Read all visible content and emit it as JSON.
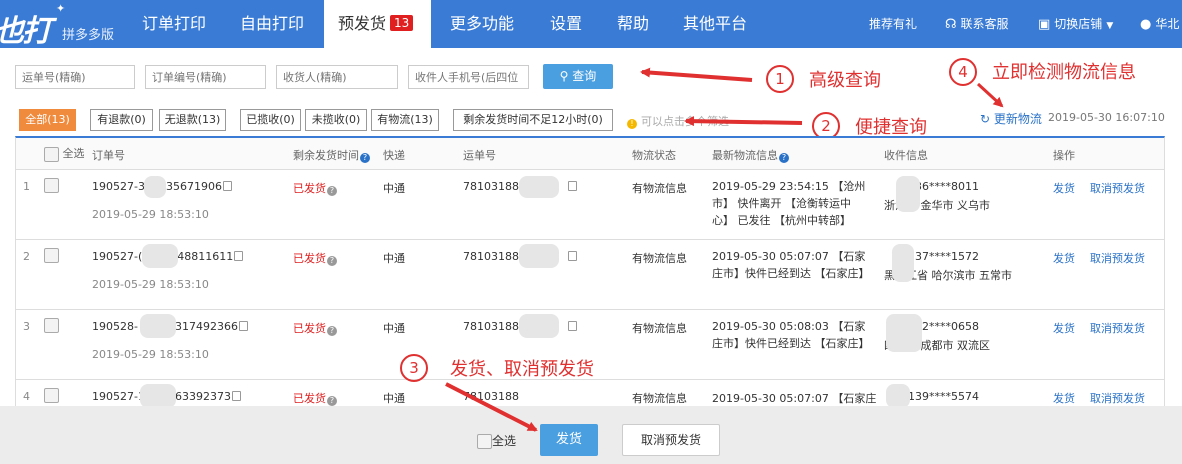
{
  "app": {
    "logo_text": "也打",
    "logo_sub": "拼多多版"
  },
  "nav": {
    "items": [
      {
        "label": "订单打印"
      },
      {
        "label": "自由打印"
      },
      {
        "label": "预发货",
        "badge": "13"
      },
      {
        "label": "更多功能"
      },
      {
        "label": "设置"
      },
      {
        "label": "帮助"
      },
      {
        "label": "其他平台"
      }
    ],
    "right": {
      "recommend": "推荐有礼",
      "contact": "联系客服",
      "switch_shop": "切换店铺",
      "user": "华北"
    }
  },
  "search": {
    "waybill_placeholder": "运单号(精确)",
    "order_placeholder": "订单编号(精确)",
    "receiver_placeholder": "收货人(精确)",
    "phone_placeholder": "收件人手机号(后四位",
    "query_label": "查询"
  },
  "annotations": {
    "a1_num": "1",
    "a1_text": "高级查询",
    "a2_num": "2",
    "a2_text": "便捷查询",
    "a3_num": "3",
    "a3_text": "发货、取消预发货",
    "a4_num": "4",
    "a4_text": "立即检测物流信息"
  },
  "filters": {
    "tabs": [
      {
        "label": "全部(13)"
      },
      {
        "label": "有退款(0)"
      },
      {
        "label": "无退款(13)"
      },
      {
        "label": "已揽收(0)"
      },
      {
        "label": "未揽收(0)"
      },
      {
        "label": "有物流(13)"
      },
      {
        "label": "剩余发货时间不足12小时(0)"
      }
    ],
    "hint": "可以点击多个筛选",
    "refresh_label": "更新物流",
    "refresh_time": "2019-05-30 16:07:10"
  },
  "table": {
    "headers": {
      "select_all": "全选",
      "order_no": "订单号",
      "remaining": "剩余发货时间",
      "express": "快递",
      "waybill": "运单号",
      "logistics_status": "物流状态",
      "latest_logistics": "最新物流信息",
      "receiver": "收件信息",
      "action": "操作"
    },
    "rows": [
      {
        "index": "1",
        "order_no": "190527-3",
        "order_no_tail": "035671906",
        "order_time": "2019-05-29 18:53:10",
        "remaining": "已发货",
        "express": "中通",
        "waybill": "78103188",
        "logistics_status": "有物流信息",
        "latest_logistics": "2019-05-29 23:54:15 【沧州市】 快件离开 【沧衡转运中心】 已发往 【杭州中转部】",
        "receiver_line1": "136****8011",
        "receiver_line2": "浙江省 金华市 义乌市",
        "ship": "发货",
        "cancel": "取消预发货"
      },
      {
        "index": "2",
        "order_no": "190527-(",
        "order_no_tail": "248811611",
        "order_time": "2019-05-29 18:53:10",
        "remaining": "已发货",
        "express": "中通",
        "waybill": "78103188",
        "logistics_status": "有物流信息",
        "latest_logistics": "2019-05-30 05:07:07 【石家庄市】快件已经到达 【石家庄】",
        "receiver_line1": "137****1572",
        "receiver_line2": "黑龙江省 哈尔滨市 五常市",
        "ship": "发货",
        "cancel": "取消预发货"
      },
      {
        "index": "3",
        "order_no": "190528-",
        "order_no_tail": "3317492366",
        "order_time": "2019-05-29 18:53:10",
        "remaining": "已发货",
        "express": "中通",
        "waybill": "78103188",
        "logistics_status": "有物流信息",
        "latest_logistics": "2019-05-30 05:08:03 【石家庄市】快件已经到达 【石家庄】",
        "receiver_line1": "182****0658",
        "receiver_line2": "四川省 成都市 双流区",
        "ship": "发货",
        "cancel": "取消预发货"
      },
      {
        "index": "4",
        "order_no": "190527-1",
        "order_no_tail": "63392373",
        "order_time": "",
        "remaining": "已发货",
        "express": "中通",
        "waybill": "78103188",
        "logistics_status": "有物流信息",
        "latest_logistics": "2019-05-30 05:07:07 【石家庄",
        "receiver_line1": "139****5574",
        "receiver_line2": "",
        "ship": "发货",
        "cancel": "取消预发货"
      }
    ]
  },
  "bottom": {
    "select_all": "全选",
    "ship_label": "发货",
    "cancel_label": "取消预发货"
  },
  "colors": {
    "nav_bg": "#3a7bd5",
    "accent": "#4a9fe0",
    "annotation": "#e03030",
    "active_filter": "#f08a3c"
  }
}
